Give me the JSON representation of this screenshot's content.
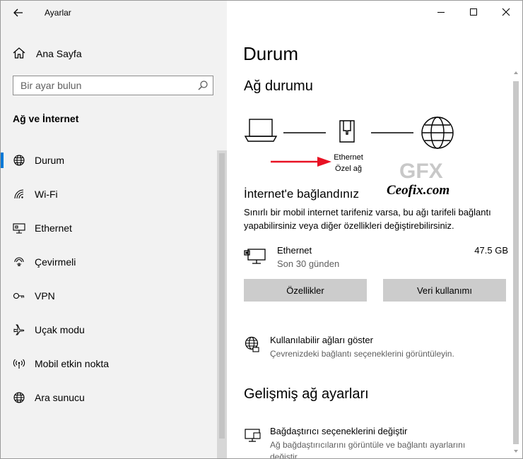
{
  "window": {
    "title": "Ayarlar"
  },
  "sidebar": {
    "home_label": "Ana Sayfa",
    "search_placeholder": "Bir ayar bulun",
    "section_title": "Ağ ve İnternet",
    "items": [
      {
        "label": "Durum",
        "icon": "globe-icon",
        "active": true
      },
      {
        "label": "Wi-Fi",
        "icon": "wifi-icon"
      },
      {
        "label": "Ethernet",
        "icon": "ethernet-icon"
      },
      {
        "label": "Çevirmeli",
        "icon": "dialup-icon"
      },
      {
        "label": "VPN",
        "icon": "vpn-icon"
      },
      {
        "label": "Uçak modu",
        "icon": "airplane-icon"
      },
      {
        "label": "Mobil etkin nokta",
        "icon": "hotspot-icon"
      },
      {
        "label": "Ara sunucu",
        "icon": "globe-icon"
      }
    ]
  },
  "main": {
    "title": "Durum",
    "network_status_heading": "Ağ durumu",
    "network_name": "Ethernet",
    "network_type": "Özel ağ",
    "connected_heading": "İnternet'e bağlandınız",
    "description_line1": "Sınırlı bir mobil internet tarifeniz varsa, bu ağı tarifeli bağlantı",
    "description_line2": "yapabilirsiniz veya diğer özellikleri değiştirebilirsiniz.",
    "connection": {
      "name": "Ethernet",
      "period": "Son 30 günden",
      "usage": "47.5 GB"
    },
    "buttons": {
      "properties": "Özellikler",
      "data_usage": "Veri kullanımı"
    },
    "show_networks": {
      "title": "Kullanılabilir ağları göster",
      "subtitle": "Çevrenizdeki bağlantı seçeneklerini görüntüleyin."
    },
    "advanced_heading": "Gelişmiş ağ ayarları",
    "adapter_options": {
      "title": "Bağdaştırıcı seçeneklerini değiştir",
      "subtitle": "Ağ bağdaştırıcılarını görüntüle ve bağlantı ayarlarını değiştir"
    }
  },
  "watermark": {
    "logo": "GFX",
    "text": "Ceofix.com"
  },
  "colors": {
    "accent": "#0078d7",
    "arrow": "#e81123",
    "sidebar_bg": "#f2f2f2",
    "button_bg": "#cccccc"
  }
}
